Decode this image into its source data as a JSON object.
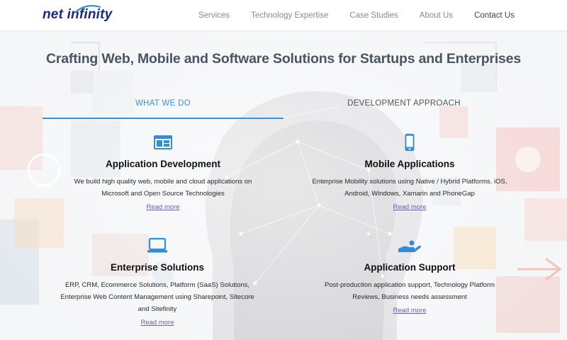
{
  "header": {
    "logo_text": "net infinity",
    "nav": [
      {
        "label": "Services"
      },
      {
        "label": "Technology Expertise"
      },
      {
        "label": "Case Studies"
      },
      {
        "label": "About Us"
      },
      {
        "label": "Contact Us"
      }
    ]
  },
  "main": {
    "headline": "Crafting Web, Mobile and Software Solutions for Startups and Enterprises",
    "tabs": [
      {
        "label": "WHAT WE DO"
      },
      {
        "label": "DEVELOPMENT APPROACH"
      }
    ],
    "services": [
      {
        "icon": "browser-window-icon",
        "title": "Application Development",
        "description": "We build high quality web, mobile and cloud applications on Microsoft and Open Source Technologies",
        "link": "Read more"
      },
      {
        "icon": "smartphone-icon",
        "title": "Mobile Applications",
        "description": "Enterprise Mobility solutions using Native / Hybrid Platforms. iOS, Android, Windows, Xamarin and PhoneGap",
        "link": "Read more"
      },
      {
        "icon": "laptop-icon",
        "title": "Enterprise Solutions",
        "description": "ERP, CRM, Ecommerce Solutions, Platform (SaaS) Solutions, Enterprise Web Content Management using Sharepoint, Sitecore and Sitefinity",
        "link": "Read more"
      },
      {
        "icon": "support-hand-icon",
        "title": "Application Support",
        "description": "Post-production application support, Technology Platform Reviews, Business needs assessment",
        "link": "Read more"
      }
    ]
  },
  "colors": {
    "accent": "#3a8fd6",
    "icon_blue": "#2f8fd8",
    "link": "#6b5fb0",
    "logo": "#1b2a7a"
  }
}
